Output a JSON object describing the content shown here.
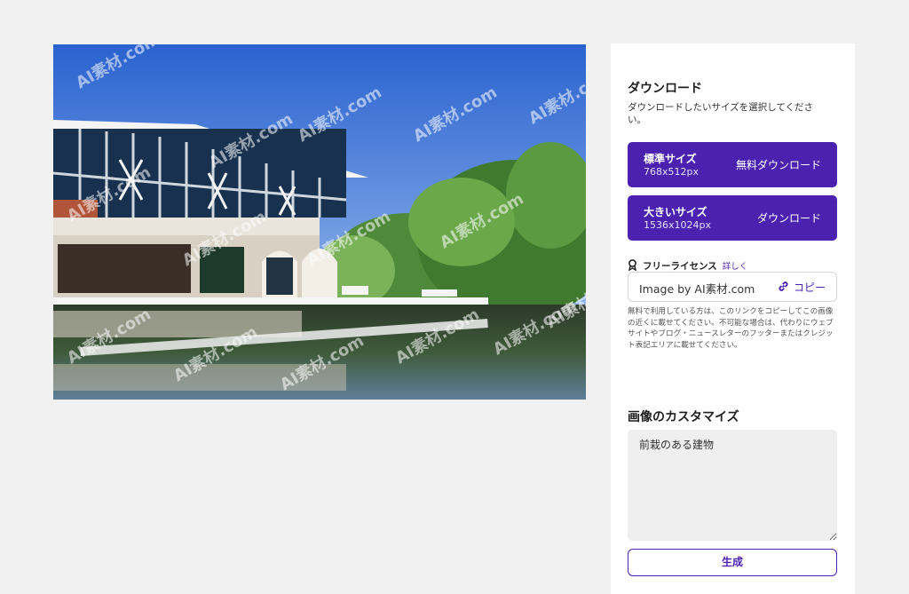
{
  "image": {
    "alt_icon": "photo-icon",
    "watermark_text": "AI素材.com"
  },
  "download": {
    "title": "ダウンロード",
    "description": "ダウンロードしたいサイズを選択してください。",
    "options": [
      {
        "name": "標準サイズ",
        "dimensions": "768x512px",
        "action": "無料ダウンロード"
      },
      {
        "name": "大きいサイズ",
        "dimensions": "1536x1024px",
        "action": "ダウンロード"
      }
    ],
    "accent_color": "#4b21b0"
  },
  "license": {
    "icon": "ribbon-icon",
    "label": "フリーライセンス",
    "detail_link": "詳しく",
    "credit_text": "Image by AI素材.com",
    "copy_icon": "link-icon",
    "copy_label": "コピー",
    "note": "無料で利用している方は、このリンクをコピーしてこの画像の近くに載せてください。不可能な場合は、代わりにウェブサイトやブログ・ニュースレターのフッターまたはクレジット表記エリアに載せてください。"
  },
  "customize": {
    "title": "画像のカスタマイズ",
    "prompt_value": "前栽のある建物",
    "generate_label": "生成"
  }
}
